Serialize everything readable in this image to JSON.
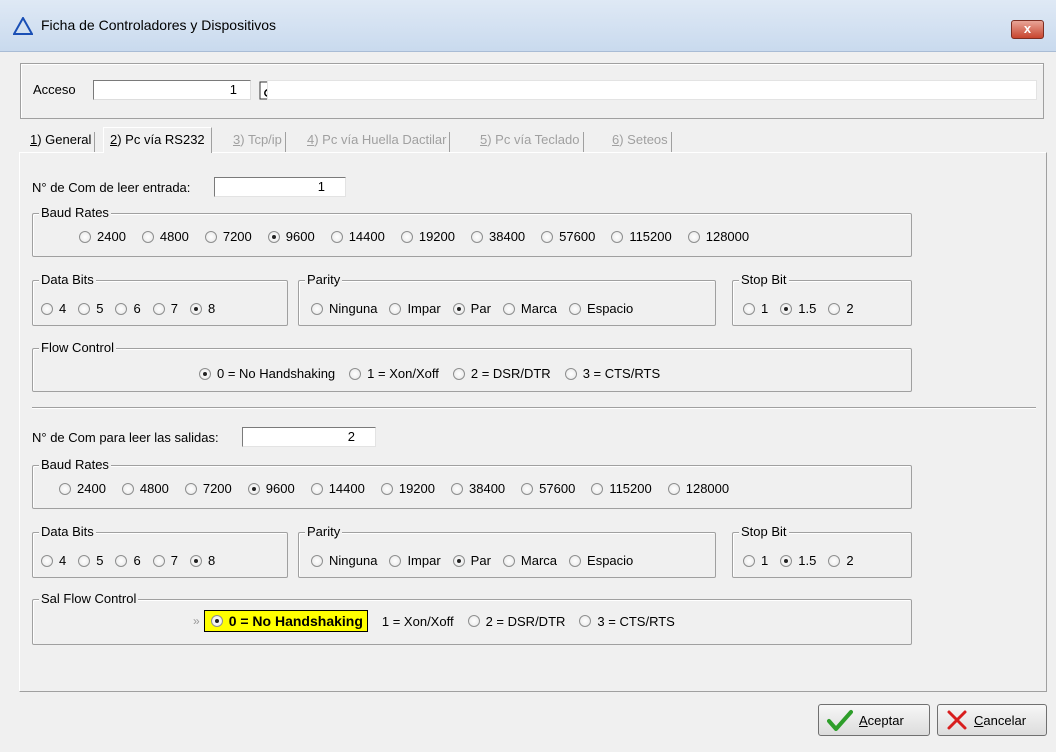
{
  "window": {
    "title": "Ficha de  Controladores y Dispositivos",
    "close_label": "x"
  },
  "access": {
    "label": "Acceso",
    "value": "1",
    "description": ""
  },
  "tabs": [
    {
      "key": "1",
      "label": ") General",
      "enabled": true,
      "active": false
    },
    {
      "key": "2",
      "label": ") Pc vía RS232",
      "enabled": true,
      "active": true
    },
    {
      "key": "3",
      "label": ") Tcp/ip",
      "enabled": false,
      "active": false
    },
    {
      "key": "4",
      "label": ") Pc vía Huella Dactilar",
      "enabled": false,
      "active": false
    },
    {
      "key": "5",
      "label": ") Pc vía Teclado",
      "enabled": false,
      "active": false
    },
    {
      "key": "6",
      "label": ") Seteos",
      "enabled": false,
      "active": false
    }
  ],
  "input_section": {
    "com_label": "N° de Com de leer entrada:",
    "com_value": "1",
    "baud": {
      "legend": "Baud Rates",
      "options": [
        "2400",
        "4800",
        "7200",
        "9600",
        "14400",
        "19200",
        "38400",
        "57600",
        "115200",
        "128000"
      ],
      "selected": "9600"
    },
    "data_bits": {
      "legend": "Data Bits",
      "options": [
        "4",
        "5",
        "6",
        "7",
        "8"
      ],
      "selected": "8"
    },
    "parity": {
      "legend": "Parity",
      "options": [
        "Ninguna",
        "Impar",
        "Par",
        "Marca",
        "Espacio"
      ],
      "selected": "Par"
    },
    "stop_bit": {
      "legend": "Stop Bit",
      "options": [
        "1",
        "1.5",
        "2"
      ],
      "selected": "1.5"
    },
    "flow": {
      "legend": "Flow Control",
      "options": [
        "0 = No Handshaking",
        "1 = Xon/Xoff",
        "2 = DSR/DTR",
        "3 = CTS/RTS"
      ],
      "selected": "0 = No Handshaking"
    }
  },
  "output_section": {
    "com_label": "N° de Com para leer las salidas:",
    "com_value": "2",
    "baud": {
      "legend": "Baud Rates",
      "options": [
        "2400",
        "4800",
        "7200",
        "9600",
        "14400",
        "19200",
        "38400",
        "57600",
        "115200",
        "128000"
      ],
      "selected": "9600"
    },
    "data_bits": {
      "legend": "Data Bits",
      "options": [
        "4",
        "5",
        "6",
        "7",
        "8"
      ],
      "selected": "8"
    },
    "parity": {
      "legend": "Parity",
      "options": [
        "Ninguna",
        "Impar",
        "Par",
        "Marca",
        "Espacio"
      ],
      "selected": "Par"
    },
    "stop_bit": {
      "legend": "Stop Bit",
      "options": [
        "1",
        "1.5",
        "2"
      ],
      "selected": "1.5"
    },
    "flow": {
      "legend": "Sal Flow Control",
      "options": [
        "0 = No Handshaking",
        "1 = Xon/Xoff",
        "2 = DSR/DTR",
        "3 = CTS/RTS"
      ],
      "selected": "0 = No Handshaking",
      "focus_marker": "»"
    }
  },
  "buttons": {
    "accept_hotkey": "A",
    "accept_rest": "ceptar",
    "cancel_hotkey": "C",
    "cancel_rest": "ancelar"
  },
  "colors": {
    "focus_highlight": "#ffff00",
    "accept_check": "#2e9e2a",
    "cancel_x": "#d81e1e",
    "title_triangle": "#1a4fb5"
  }
}
